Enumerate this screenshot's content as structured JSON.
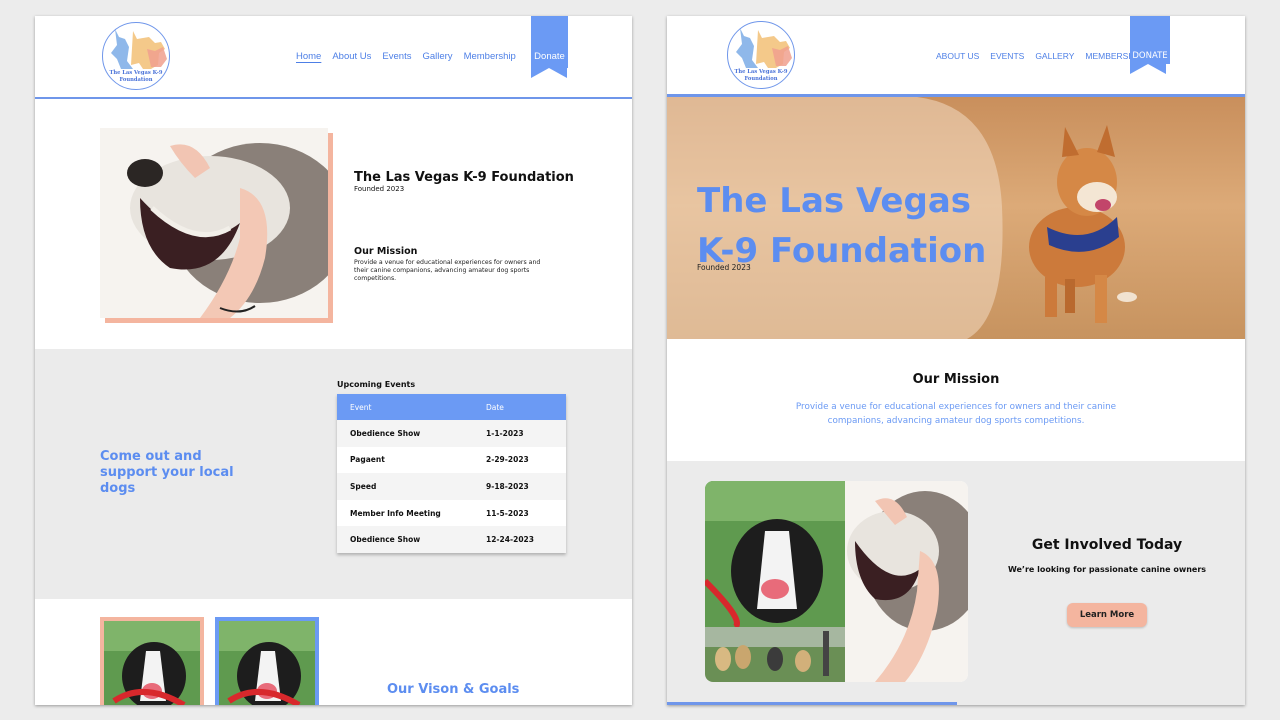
{
  "colors": {
    "accent_blue": "#6b9af4",
    "link_blue": "#4d7fe6",
    "salmon": "#f4b59f",
    "section_gray": "#ebebeb"
  },
  "logo": {
    "line1": "The Las Vegas K-9",
    "line2": "Foundation",
    "icon": "dogs-logo-icon"
  },
  "panel_a": {
    "nav": {
      "items": [
        "Home",
        "About Us",
        "Events",
        "Gallery",
        "Membership"
      ],
      "donate": "Donate",
      "active": "Home"
    },
    "hero": {
      "title": "The Las Vegas K-9 Foundation",
      "subtitle": "Founded 2023",
      "mission_heading": "Our Mission",
      "mission_text": "Provide a venue for educational experiences for owners and their canine companions, advancing amateur dog sports competitions."
    },
    "support_text": "Come out and support your local dogs",
    "events": {
      "title": "Upcoming Events",
      "headers": [
        "Event",
        "Date"
      ],
      "rows": [
        [
          "Obedience Show",
          "1-1-2023"
        ],
        [
          "Pagaent",
          "2-29-2023"
        ],
        [
          "Speed",
          "9-18-2023"
        ],
        [
          "Member Info Meeting",
          "11-5-2023"
        ],
        [
          "Obedience Show",
          "12-24-2023"
        ]
      ]
    },
    "vision_heading": "Our Vison & Goals"
  },
  "panel_b": {
    "nav": {
      "items": [
        "ABOUT US",
        "EVENTS",
        "GALLERY",
        "MEMBERSHIP"
      ],
      "donate": "DONATE"
    },
    "hero": {
      "title_line1": "The Las Vegas",
      "title_line2": "K-9 Foundation",
      "subtitle": "Founded 2023"
    },
    "mission": {
      "heading": "Our Mission",
      "text": "Provide a venue for educational experiences for owners and their canine companions, advancing amateur dog sports competitions."
    },
    "involved": {
      "heading": "Get Involved Today",
      "text": "We’re looking for passionate canine owners",
      "button": "Learn More"
    }
  }
}
